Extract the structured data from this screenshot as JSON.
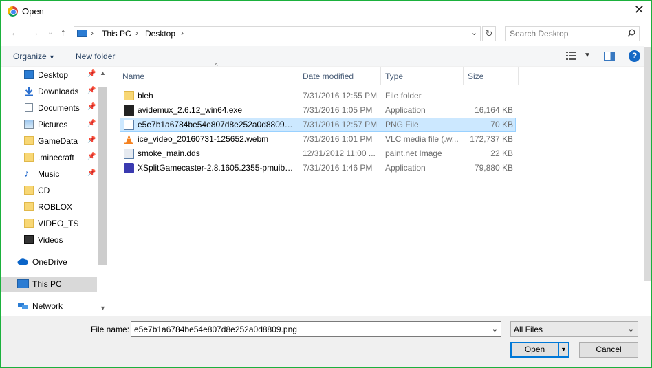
{
  "window": {
    "title": "Open"
  },
  "address": {
    "crumbs": [
      "This PC",
      "Desktop"
    ],
    "search_placeholder": "Search Desktop"
  },
  "toolbar": {
    "organize_label": "Organize",
    "new_folder_label": "New folder"
  },
  "nav": {
    "items": [
      {
        "label": "Desktop",
        "icon": "desktop-icon",
        "pinned": true
      },
      {
        "label": "Downloads",
        "icon": "download-icon",
        "pinned": true
      },
      {
        "label": "Documents",
        "icon": "document-icon",
        "pinned": true
      },
      {
        "label": "Pictures",
        "icon": "picture-icon",
        "pinned": true
      },
      {
        "label": "GameData",
        "icon": "folder-icon",
        "pinned": true
      },
      {
        "label": ".minecraft",
        "icon": "folder-icon",
        "pinned": true
      },
      {
        "label": "Music",
        "icon": "music-icon",
        "pinned": true
      },
      {
        "label": "CD",
        "icon": "folder-icon",
        "pinned": false
      },
      {
        "label": "ROBLOX",
        "icon": "folder-icon",
        "pinned": false
      },
      {
        "label": "VIDEO_TS",
        "icon": "folder-icon",
        "pinned": false
      },
      {
        "label": "Videos",
        "icon": "video-icon",
        "pinned": false
      },
      {
        "label": "OneDrive",
        "icon": "cloud-icon",
        "pinned": false
      },
      {
        "label": "This PC",
        "icon": "computer-icon",
        "pinned": false,
        "selected": true
      },
      {
        "label": "Network",
        "icon": "network-icon",
        "pinned": false
      }
    ]
  },
  "files": {
    "columns": [
      "Name",
      "Date modified",
      "Type",
      "Size"
    ],
    "rows": [
      {
        "name": "bleh",
        "date": "7/31/2016 12:55 PM",
        "type": "File folder",
        "size": "",
        "icon": "folder-icon"
      },
      {
        "name": "avidemux_2.6.12_win64.exe",
        "date": "7/31/2016 1:05 PM",
        "type": "Application",
        "size": "16,164 KB",
        "icon": "clapper-icon"
      },
      {
        "name": "e5e7b1a6784be54e807d8e252a0d8809.png",
        "date": "7/31/2016 12:57 PM",
        "type": "PNG File",
        "size": "70 KB",
        "icon": "image-file-icon",
        "selected": true
      },
      {
        "name": "ice_video_20160731-125652.webm",
        "date": "7/31/2016 1:01 PM",
        "type": "VLC media file (.w...",
        "size": "172,737 KB",
        "icon": "vlc-cone-icon"
      },
      {
        "name": "smoke_main.dds",
        "date": "12/31/2012 11:00 ...",
        "type": "paint.net Image",
        "size": "22 KB",
        "icon": "paintnet-icon"
      },
      {
        "name": "XSplitGamecaster-2.8.1605.2355-pmuibl....",
        "date": "7/31/2016 1:46 PM",
        "type": "Application",
        "size": "79,880 KB",
        "icon": "gamepad-icon"
      }
    ]
  },
  "bottom": {
    "file_name_label": "File name:",
    "file_name_value": "e5e7b1a6784be54e807d8e252a0d8809.png",
    "filter_value": "All Files",
    "open_label": "Open",
    "cancel_label": "Cancel"
  }
}
